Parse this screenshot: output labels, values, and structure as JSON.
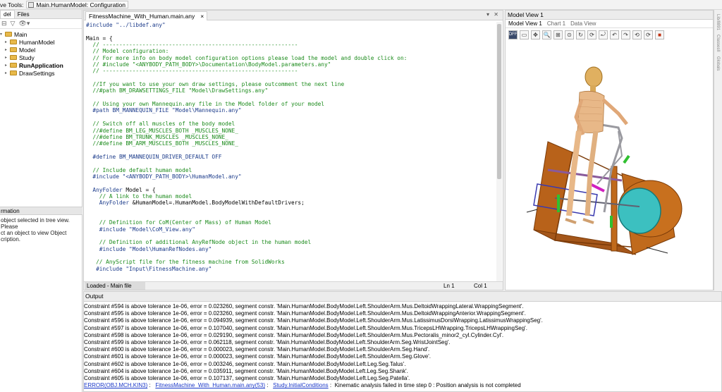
{
  "toolbar": {
    "tools_label": "ve Tools:",
    "config_label": "Main.HumanModel: Configuration"
  },
  "left": {
    "tabs": [
      "del",
      "Files"
    ],
    "tree": [
      {
        "label": "Main",
        "bold": false,
        "level": 0
      },
      {
        "label": "HumanModel",
        "bold": false,
        "level": 1
      },
      {
        "label": "Model",
        "bold": false,
        "level": 1
      },
      {
        "label": "Study",
        "bold": false,
        "level": 1
      },
      {
        "label": "RunApplication",
        "bold": true,
        "level": 1
      },
      {
        "label": "DrawSettings",
        "bold": false,
        "level": 1
      }
    ],
    "info_title": "rmation",
    "info_text": [
      "object selected in tree view. Please",
      "ct an object to view Object",
      "cription."
    ]
  },
  "editor": {
    "tab_label": "FitnessMachine_With_Human.main.any",
    "tab_close": "×",
    "controls": "▾ ✕",
    "lines": [
      [
        [
          "k",
          "#include \"../libdef.any\""
        ]
      ],
      [
        [
          "n",
          ""
        ]
      ],
      [
        [
          "n",
          "Main = {"
        ]
      ],
      [
        [
          "c",
          "  // -----------------------------------------------------------"
        ]
      ],
      [
        [
          "c",
          "  // Model configuration:"
        ]
      ],
      [
        [
          "c",
          "  // For more info on body model configuration options please load the model and double click on:"
        ]
      ],
      [
        [
          "c",
          "  // #include \"<ANYBODY_PATH_BODY>\\Documentation\\BodyModel.parameters.any\""
        ]
      ],
      [
        [
          "c",
          "  // -----------------------------------------------------------"
        ]
      ],
      [
        [
          "n",
          ""
        ]
      ],
      [
        [
          "c",
          "  //If you want to use your own draw settings, please outcomment the next line"
        ]
      ],
      [
        [
          "c",
          "  //#path BM_DRAWSETTINGS_FILE \"Model\\DrawSettings.any\""
        ]
      ],
      [
        [
          "n",
          ""
        ]
      ],
      [
        [
          "c",
          "  // Using your own Mannequin.any file in the Model folder of your model"
        ]
      ],
      [
        [
          "k",
          "  #path BM_MANNEQUIN_FILE \"Model\\Mannequin.any\""
        ]
      ],
      [
        [
          "n",
          ""
        ]
      ],
      [
        [
          "c",
          "  // Switch off all muscles of the body model"
        ]
      ],
      [
        [
          "c",
          "  //#define BM_LEG_MUSCLES_BOTH _MUSCLES_NONE_"
        ]
      ],
      [
        [
          "c",
          "  //#define BM_TRUNK_MUSCLES _MUSCLES_NONE_"
        ]
      ],
      [
        [
          "c",
          "  //#define BM_ARM_MUSCLES_BOTH _MUSCLES_NONE_"
        ]
      ],
      [
        [
          "n",
          ""
        ]
      ],
      [
        [
          "k",
          "  #define BM_MANNEQUIN_DRIVER_DEFAULT OFF"
        ]
      ],
      [
        [
          "n",
          ""
        ]
      ],
      [
        [
          "c",
          "  // Include default human model"
        ]
      ],
      [
        [
          "k",
          "  #include \"<ANYBODY_PATH_BODY>\\HumanModel.any\""
        ]
      ],
      [
        [
          "n",
          ""
        ]
      ],
      [
        [
          "k",
          "  AnyFolder"
        ],
        [
          "n",
          " Model = {"
        ]
      ],
      [
        [
          "c",
          "    // A link to the human model"
        ]
      ],
      [
        [
          "k",
          "    AnyFolder"
        ],
        [
          "n",
          " &HumanModel=.HumanModel.BodyModelWithDefaultDrivers;"
        ]
      ],
      [
        [
          "n",
          ""
        ]
      ],
      [
        [
          "n",
          ""
        ]
      ],
      [
        [
          "c",
          "    // Definition for CoM(Center of Mass) of Human Model"
        ]
      ],
      [
        [
          "k",
          "    #include \"Model\\CoM_View.any\""
        ]
      ],
      [
        [
          "n",
          ""
        ]
      ],
      [
        [
          "c",
          "    // Definition of additional AnyRefNode object in the human model"
        ]
      ],
      [
        [
          "k",
          "    #include \"Model\\HumanRefNodes.any\""
        ]
      ],
      [
        [
          "n",
          ""
        ]
      ],
      [
        [
          "c",
          "   // AnyScript file for the fitness machine from SolidWorks"
        ]
      ],
      [
        [
          "k",
          "   #include \"Input\\FitnessMachine.any\""
        ]
      ]
    ],
    "status_loaded": "Loaded - Main file",
    "status_ln": "Ln 1",
    "status_col": "Col 1"
  },
  "modelview": {
    "title": "Model View 1",
    "tabs": [
      "Model View 1",
      "Chart 1",
      "Data View"
    ]
  },
  "rstrip": [
    "Lib/8891",
    "ClassesII",
    "Globals"
  ],
  "output": {
    "title": "Output",
    "lines": [
      "Constraint #594 is above tolerance 1e-06, error = 0.023260, segment constr. 'Main.HumanModel.BodyModel.Left.ShoulderArm.Mus.DeltoidWrappingLateral.WrappingSegment'.",
      "Constraint #595 is above tolerance 1e-06, error = 0.023260, segment constr. 'Main.HumanModel.BodyModel.Left.ShoulderArm.Mus.DeltoidWrappingAnterior.WrappingSegment'.",
      "Constraint #596 is above tolerance 1e-06, error = 0.094939, segment constr. 'Main.HumanModel.BodyModel.Left.ShoulderArm.Mus.LatissimusDorsiWrapping.LatissimusWrappingSeg'.",
      "Constraint #597 is above tolerance 1e-06, error = 0.107040, segment constr. 'Main.HumanModel.BodyModel.Left.ShoulderArm.Mus.TricepsLHWrapping.TricepsLHWrappingSeg'.",
      "Constraint #598 is above tolerance 1e-06, error = 0.029190, segment constr. 'Main.HumanModel.BodyModel.Left.ShoulderArm.Mus.Pectoralis_minor2_cyl.Cylinder.Cyl'.",
      "Constraint #599 is above tolerance 1e-06, error = 0.062118, segment constr. 'Main.HumanModel.BodyModel.Left.ShoulderArm.Seg.WristJointSeg'.",
      "Constraint #600 is above tolerance 1e-06, error = 0.000023, segment constr. 'Main.HumanModel.BodyModel.Left.ShoulderArm.Seg.Hand'.",
      "Constraint #601 is above tolerance 1e-06, error = 0.000023, segment constr. 'Main.HumanModel.BodyModel.Left.ShoulderArm.Seg.Glove'.",
      "Constraint #602 is above tolerance 1e-06, error = 0.003246, segment constr. 'Main.HumanModel.BodyModel.Left.Leg.Seg.Talus'.",
      "Constraint #604 is above tolerance 1e-06, error = 0.035911, segment constr. 'Main.HumanModel.BodyModel.Left.Leg.Seg.Shank'.",
      "Constraint #605 is above tolerance 1e-06, error = 0.107137, segment constr. 'Main.HumanModel.BodyModel.Left.Leg.Seg.Patella'."
    ],
    "error_tag": "ERROR(OBJ.MCH.KIN3)",
    "error_sep": " :   ",
    "error_file": "FitnessMachine_With_Human.main.any(53)",
    "error_study": "Study.InitialConditions",
    "error_msg": " :  Kinematic analysis failed in time step 0 : Position analysis is not completed"
  }
}
